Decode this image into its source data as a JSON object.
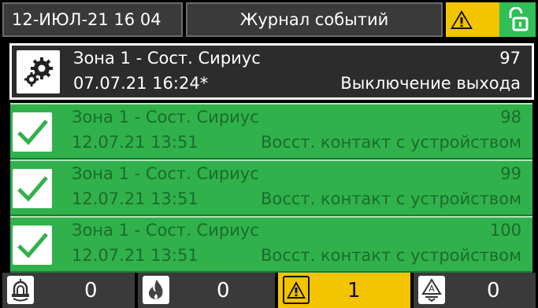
{
  "header": {
    "datetime": "12-ИЮЛ-21  16 04",
    "title": "Журнал событий",
    "status_icons": [
      "warning-icon",
      "unlocked-icon"
    ]
  },
  "events": [
    {
      "zone": "Зона 1 - Сост. Сириус",
      "number": "97",
      "datetime": "07.07.21 16:24*",
      "description": "Выключение выхода",
      "icon": "gears-icon",
      "selected": true
    },
    {
      "zone": "Зона 1 - Сост. Сириус",
      "number": "98",
      "datetime": "12.07.21 13:51",
      "description": "Восст. контакт с устройством",
      "icon": "check-icon",
      "selected": false
    },
    {
      "zone": "Зона 1 - Сост. Сириус",
      "number": "99",
      "datetime": "12.07.21 13:51",
      "description": "Восст. контакт с устройством",
      "icon": "check-icon",
      "selected": false
    },
    {
      "zone": "Зона 1 - Сост. Сириус",
      "number": "100",
      "datetime": "12.07.21 13:51",
      "description": "Восст. контакт с устройством",
      "icon": "check-icon",
      "selected": false
    }
  ],
  "footer": {
    "counters": [
      {
        "icon": "alarm-siren-icon",
        "count": "0"
      },
      {
        "icon": "fire-icon",
        "count": "0"
      },
      {
        "icon": "warning-icon",
        "count": "1"
      },
      {
        "icon": "fault-triangle-icon",
        "count": "0"
      }
    ]
  },
  "colors": {
    "accent_yellow": "#f3c400",
    "ok_green": "#30b14b",
    "panel_grey": "#3a3a3a"
  }
}
